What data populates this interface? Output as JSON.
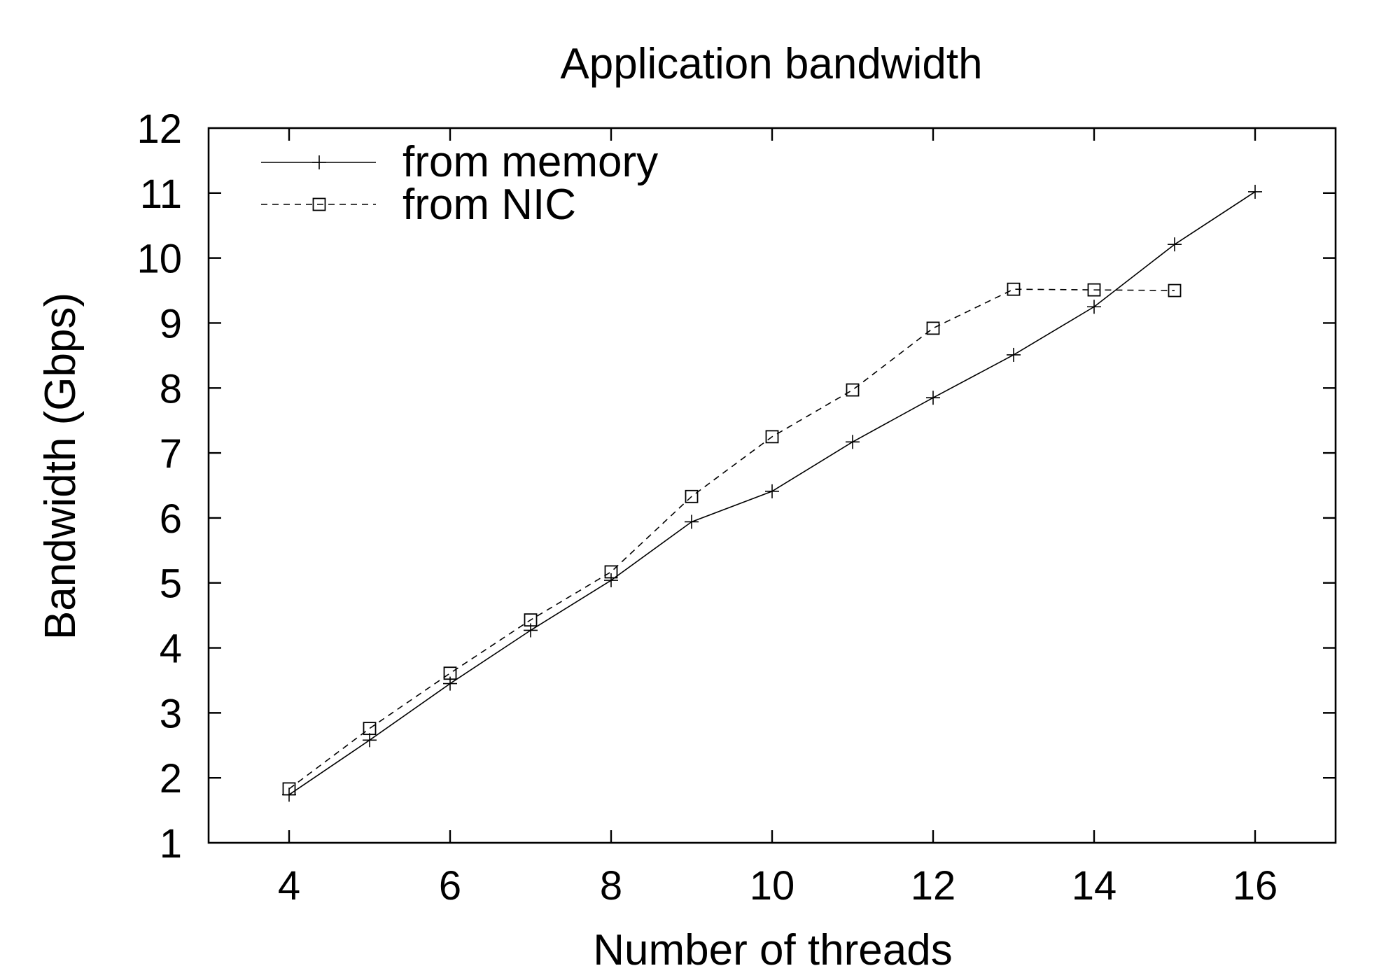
{
  "chart_data": {
    "type": "line",
    "title": "Application bandwidth",
    "xlabel": "Number of threads",
    "ylabel": "Bandwidth (Gbps)",
    "xlim": [
      3,
      17
    ],
    "ylim": [
      1,
      12
    ],
    "xticks": [
      4,
      6,
      8,
      10,
      12,
      14,
      16
    ],
    "xtick_labels": [
      "4",
      "6",
      "8",
      "10",
      "12",
      "14",
      "16"
    ],
    "yticks": [
      1,
      2,
      3,
      4,
      5,
      6,
      7,
      8,
      9,
      10,
      11,
      12
    ],
    "ytick_labels": [
      "1",
      "2",
      "3",
      "4",
      "5",
      "6",
      "7",
      "8",
      "9",
      "10",
      "11",
      "12"
    ],
    "grid": false,
    "legend_position": "top-left",
    "series": [
      {
        "name": "from memory",
        "line_style": "solid",
        "marker": "plus",
        "color": "#000000",
        "x": [
          4,
          5,
          6,
          7,
          8,
          9,
          10,
          11,
          12,
          13,
          14,
          15,
          16
        ],
        "y": [
          1.74,
          2.58,
          3.45,
          4.27,
          5.04,
          5.94,
          6.41,
          7.17,
          7.85,
          8.51,
          9.25,
          10.21,
          11.02
        ]
      },
      {
        "name": "from NIC",
        "line_style": "dashed",
        "marker": "square",
        "color": "#000000",
        "x": [
          4,
          5,
          6,
          7,
          8,
          9,
          10,
          11,
          12,
          13,
          14,
          15
        ],
        "y": [
          1.83,
          2.76,
          3.61,
          4.43,
          5.17,
          6.33,
          7.25,
          7.97,
          8.92,
          9.52,
          9.51,
          9.5
        ]
      }
    ]
  }
}
